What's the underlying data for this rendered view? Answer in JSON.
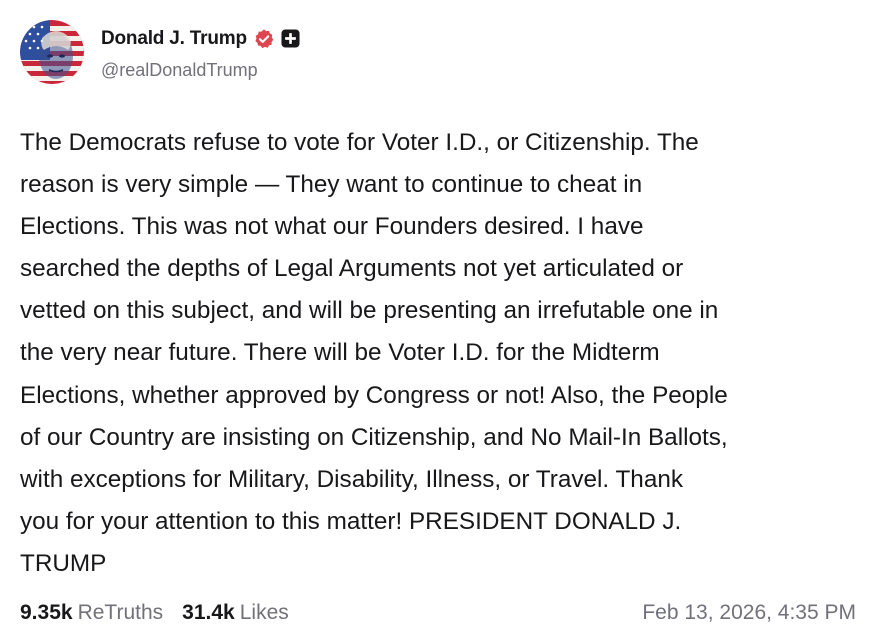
{
  "author": {
    "display_name": "Donald J. Trump",
    "handle": "@realDonaldTrump",
    "avatar_icon": "flag-portrait-avatar",
    "verified_icon": "verified-badge-icon",
    "affiliate_icon": "plus-badge-icon",
    "verified_color": "#e0464f"
  },
  "post": {
    "text": "The Democrats refuse to vote for Voter I.D., or Citizenship. The\nreason is very simple — They want to continue to cheat in\nElections. This was not what our Founders desired. I have\nsearched the depths of Legal Arguments not yet articulated or\nvetted on this subject, and will be presenting an irrefutable one in\nthe very near future. There will be Voter I.D. for the Midterm\nElections, whether approved by Congress or not! Also, the People\nof our Country are insisting on Citizenship, and No Mail-In Ballots,\nwith exceptions for Military, Disability, Illness, or Travel. Thank\nyou for your attention to this matter! PRESIDENT DONALD J.\nTRUMP"
  },
  "stats": {
    "retruths_count": "9.35k",
    "retruths_label": "ReTruths",
    "likes_count": "31.4k",
    "likes_label": "Likes"
  },
  "timestamp": "Feb 13, 2026, 4:35 PM"
}
